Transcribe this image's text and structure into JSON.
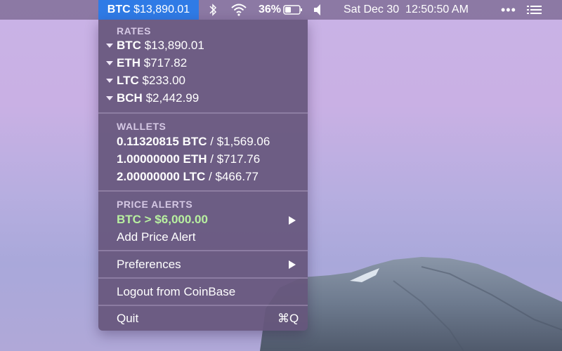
{
  "menubar": {
    "btc_symbol": "BTC",
    "btc_price": "$13,890.01",
    "battery_percent": "36%",
    "datetime": "Sat Dec 30  12:50:50 AM",
    "more_icon": "•••"
  },
  "menu": {
    "rates": {
      "title": "RATES",
      "items": [
        {
          "symbol": "BTC",
          "price": "$13,890.01"
        },
        {
          "symbol": "ETH",
          "price": "$717.82"
        },
        {
          "symbol": "LTC",
          "price": "$233.00"
        },
        {
          "symbol": "BCH",
          "price": "$2,442.99"
        }
      ]
    },
    "wallets": {
      "title": "WALLETS",
      "items": [
        {
          "amount": "0.11320815 BTC",
          "value": " / $1,569.06"
        },
        {
          "amount": "1.00000000 ETH",
          "value": " / $717.76"
        },
        {
          "amount": "2.00000000 LTC",
          "value": " / $466.77"
        }
      ]
    },
    "alerts": {
      "title": "PRICE ALERTS",
      "active_alert": "BTC > $6,000.00",
      "add_label": "Add Price Alert"
    },
    "preferences_label": "Preferences",
    "logout_label": "Logout from CoinBase",
    "quit_label": "Quit",
    "quit_shortcut": "⌘Q"
  },
  "colors": {
    "menubar_highlight": "#2f7be6",
    "alert_text": "#b8f0a0"
  },
  "icons": [
    "bluetooth-icon",
    "wifi-icon",
    "battery-icon",
    "volume-icon",
    "more-icon",
    "list-icon",
    "submenu-arrow-icon",
    "disclosure-triangle-icon"
  ]
}
